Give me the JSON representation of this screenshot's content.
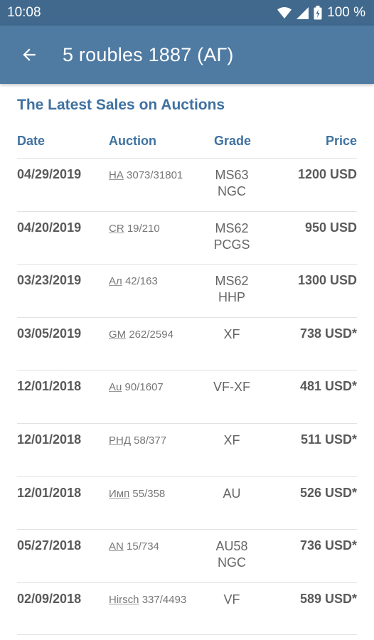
{
  "status_bar": {
    "time": "10:08",
    "battery": "100 %"
  },
  "app_bar": {
    "title": "5 roubles 1887 (АГ)",
    "back_icon": "arrow-left-icon"
  },
  "section": {
    "title": "The Latest Sales on Auctions",
    "headers": {
      "date": "Date",
      "auction": "Auction",
      "grade": "Grade",
      "price": "Price"
    }
  },
  "sales": [
    {
      "date": "04/29/2019",
      "auction_code": "НА",
      "auction_lot": "3073/31801",
      "grade": "MS63",
      "grade_service": "NGC",
      "price": "1200 USD"
    },
    {
      "date": "04/20/2019",
      "auction_code": "CR",
      "auction_lot": "19/210",
      "grade": "MS62",
      "grade_service": "PCGS",
      "price": "950 USD"
    },
    {
      "date": "03/23/2019",
      "auction_code": "Ал",
      "auction_lot": "42/163",
      "grade": "MS62",
      "grade_service": "HHP",
      "price": "1300 USD"
    },
    {
      "date": "03/05/2019",
      "auction_code": "GM",
      "auction_lot": "262/2594",
      "grade": "XF",
      "grade_service": "",
      "price": "738 USD*"
    },
    {
      "date": "12/01/2018",
      "auction_code": "Au",
      "auction_lot": "90/1607",
      "grade": "VF-XF",
      "grade_service": "",
      "price": "481 USD*"
    },
    {
      "date": "12/01/2018",
      "auction_code": "РНД",
      "auction_lot": "58/377",
      "grade": "XF",
      "grade_service": "",
      "price": "511 USD*"
    },
    {
      "date": "12/01/2018",
      "auction_code": "Имп",
      "auction_lot": "55/358",
      "grade": "AU",
      "grade_service": "",
      "price": "526 USD*"
    },
    {
      "date": "05/27/2018",
      "auction_code": "AN",
      "auction_lot": "15/734",
      "grade": "AU58",
      "grade_service": "NGC",
      "price": "736 USD*"
    },
    {
      "date": "02/09/2018",
      "auction_code": "Hirsch",
      "auction_lot": "337/4493",
      "grade": "VF",
      "grade_service": "",
      "price": "589 USD*"
    }
  ],
  "colors": {
    "status_bar": "#41698e",
    "app_bar": "#4f7aa2",
    "accent": "#3f72a0"
  }
}
